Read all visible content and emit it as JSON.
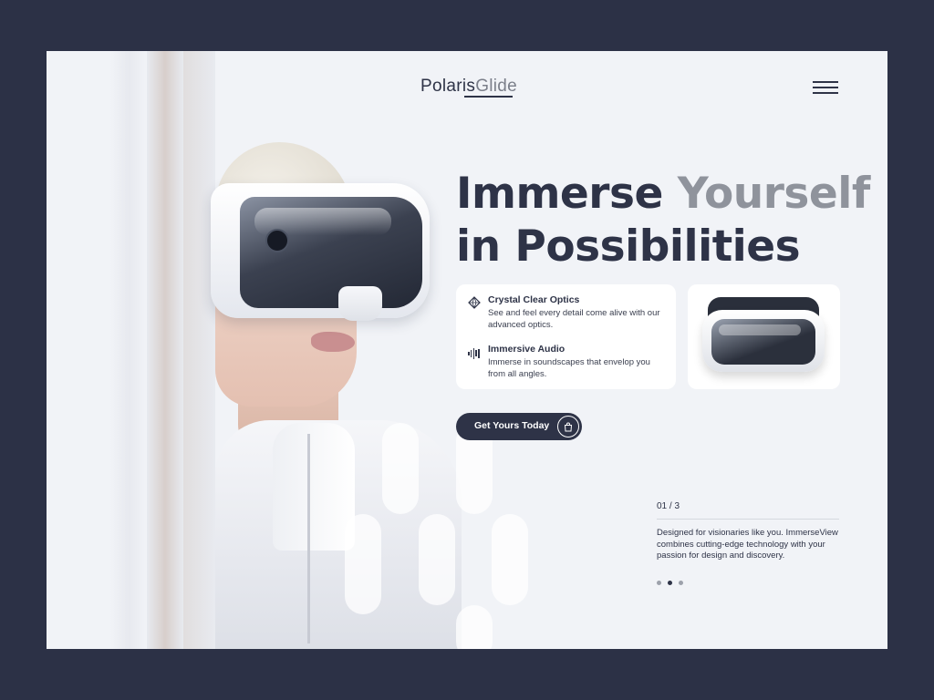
{
  "brand": {
    "name_primary": "Polaris",
    "name_accent": "Glide"
  },
  "headline": {
    "line1_dark": "Immerse",
    "line1_gray": "Yourself",
    "line2": "in Possibilities"
  },
  "features": [
    {
      "icon": "diamond-icon",
      "title": "Crystal Clear Optics",
      "description": "See and feel every detail come alive with our advanced optics."
    },
    {
      "icon": "audio-wave-icon",
      "title": "Immersive Audio",
      "description": "Immerse in soundscapes that envelop you from all angles."
    }
  ],
  "cta": {
    "label": "Get Yours Today",
    "icon": "shopping-bag-icon"
  },
  "slider": {
    "counter": "01 / 3",
    "description": "Designed for visionaries like you. ImmerseView combines cutting-edge technology with your passion for design and discovery.",
    "total_dots": 3,
    "active_dot": 2
  },
  "colors": {
    "page_bg": "#2c3146",
    "card_bg": "#f1f3f7",
    "primary": "#2e3347",
    "muted": "#8f939c"
  }
}
